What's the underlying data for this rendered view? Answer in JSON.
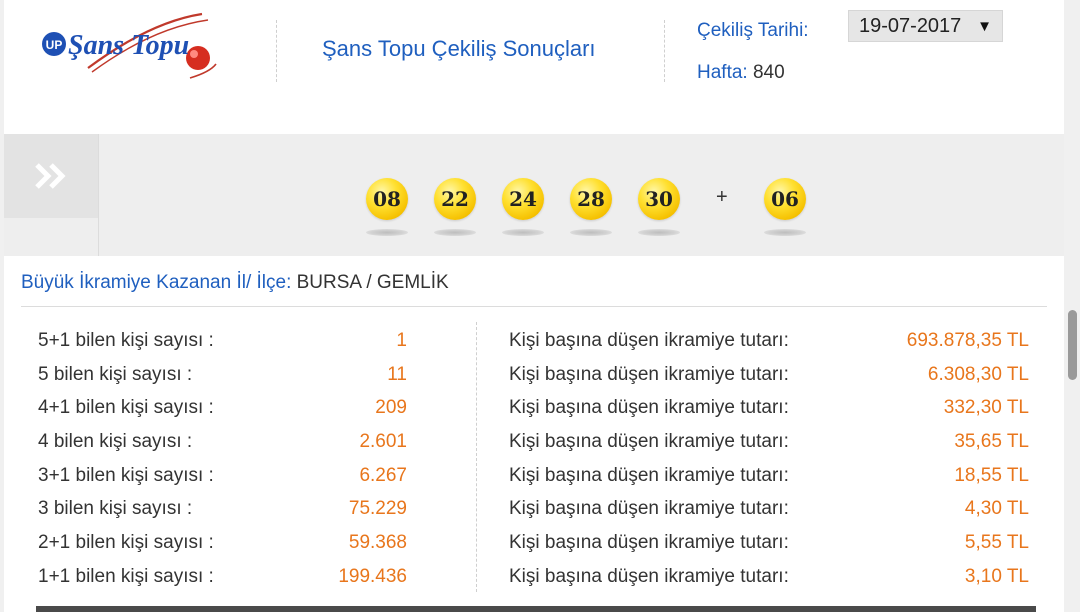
{
  "header": {
    "logo_text": "Şans Topu",
    "title": "Şans Topu Çekiliş Sonuçları",
    "date_label": "Çekiliş Tarihi:",
    "date_value": "19-07-2017",
    "week_label": "Hafta:",
    "week_value": "840"
  },
  "draw": {
    "numbers": [
      "08",
      "22",
      "24",
      "28",
      "30"
    ],
    "plus_sign": "+",
    "bonus": "06"
  },
  "region": {
    "label": "Büyük İkramiye Kazanan İl/ İlçe:",
    "value": "BURSA / GEMLİK"
  },
  "results": [
    {
      "label": "5+1 bilen kişi sayısı :",
      "count": "1",
      "prize_label": "Kişi başına düşen ikramiye tutarı:",
      "prize": "693.878,35 TL"
    },
    {
      "label": "5 bilen kişi sayısı :",
      "count": "11",
      "prize_label": "Kişi başına düşen ikramiye tutarı:",
      "prize": "6.308,30 TL"
    },
    {
      "label": "4+1 bilen kişi sayısı :",
      "count": "209",
      "prize_label": "Kişi başına düşen ikramiye tutarı:",
      "prize": "332,30 TL"
    },
    {
      "label": "4 bilen kişi sayısı :",
      "count": "2.601",
      "prize_label": "Kişi başına düşen ikramiye tutarı:",
      "prize": "35,65 TL"
    },
    {
      "label": "3+1 bilen kişi sayısı :",
      "count": "6.267",
      "prize_label": "Kişi başına düşen ikramiye tutarı:",
      "prize": "18,55 TL"
    },
    {
      "label": "3 bilen kişi sayısı :",
      "count": "75.229",
      "prize_label": "Kişi başına düşen ikramiye tutarı:",
      "prize": "4,30 TL"
    },
    {
      "label": "2+1 bilen kişi sayısı :",
      "count": "59.368",
      "prize_label": "Kişi başına düşen ikramiye tutarı:",
      "prize": "5,55 TL"
    },
    {
      "label": "1+1 bilen kişi sayısı :",
      "count": "199.436",
      "prize_label": "Kişi başına düşen ikramiye tutarı:",
      "prize": "3,10 TL"
    }
  ],
  "icons": {
    "band_button": "double-chevron-right-icon",
    "date_select": "caret-down-icon"
  },
  "colors": {
    "accent_blue": "#1f5fbf",
    "value_orange": "#e8761c",
    "ball_yellow": "#ffd21f"
  }
}
